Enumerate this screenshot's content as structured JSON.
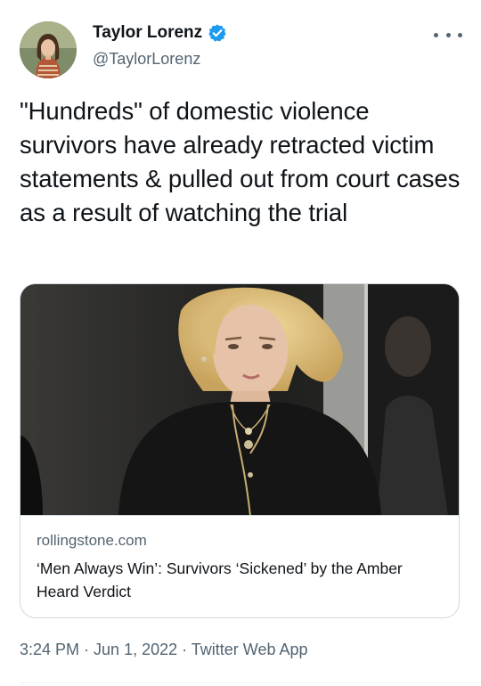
{
  "author": {
    "display_name": "Taylor Lorenz",
    "handle": "@TaylorLorenz",
    "verified": true,
    "avatar_icon": "profile-photo"
  },
  "menu_icon": "more-dots-icon",
  "tweet": {
    "text": "\"Hundreds\" of domestic violence survivors have already retracted victim statements & pulled out from court cases as a result of watching the trial"
  },
  "card": {
    "domain": "rollingstone.com",
    "title": "‘Men Always Win’: Survivors ‘Sickened’ by the Amber Heard Verdict",
    "image_icon": "article-photo"
  },
  "meta": {
    "time": "3:24 PM",
    "date": "Jun 1, 2022",
    "source": "Twitter Web App",
    "separator": " · "
  },
  "colors": {
    "verified_blue": "#1d9bf0",
    "secondary_text": "#536471",
    "border": "#cfd9de"
  }
}
